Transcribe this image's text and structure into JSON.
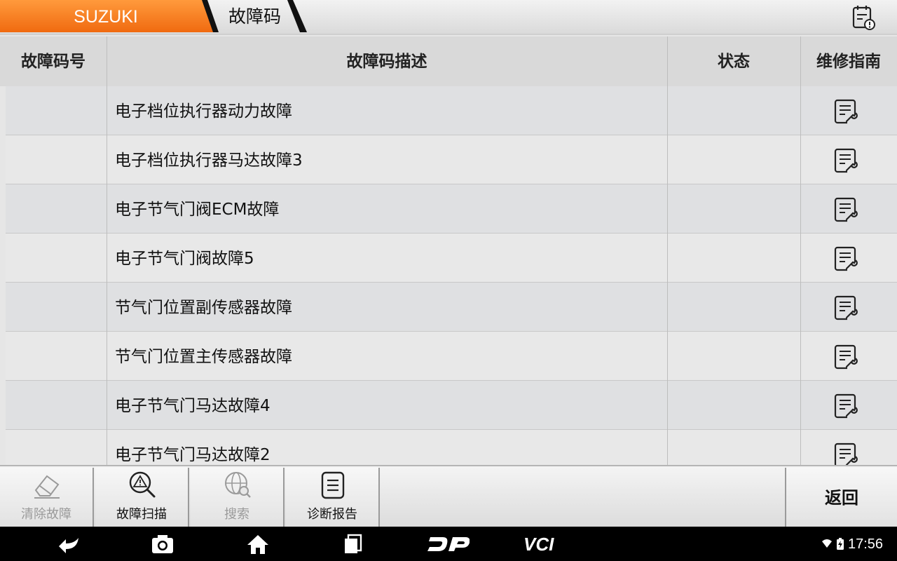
{
  "header": {
    "brand": "SUZUKI",
    "page_title": "故障码",
    "brand_color": "#f47b20"
  },
  "table": {
    "columns": [
      "故障码号",
      "故障码描述",
      "状态",
      "维修指南"
    ],
    "rows": [
      {
        "code": "",
        "description": "电子档位执行器动力故障",
        "status": ""
      },
      {
        "code": "",
        "description": "电子档位执行器马达故障3",
        "status": ""
      },
      {
        "code": "",
        "description": "电子节气门阀ECM故障",
        "status": ""
      },
      {
        "code": "",
        "description": "电子节气门阀故障5",
        "status": ""
      },
      {
        "code": "",
        "description": "节气门位置副传感器故障",
        "status": ""
      },
      {
        "code": "",
        "description": "节气门位置主传感器故障",
        "status": ""
      },
      {
        "code": "",
        "description": "电子节气门马达故障4",
        "status": ""
      },
      {
        "code": "",
        "description": "电子节气门马达故障2",
        "status": ""
      }
    ]
  },
  "toolbar": {
    "clear_label": "清除故障",
    "scan_label": "故障扫描",
    "search_label": "搜索",
    "report_label": "诊断报告",
    "back_label": "返回"
  },
  "navbar": {
    "dp_label": "DP",
    "vci_label": "VCI",
    "time": "17:56"
  },
  "icons": {
    "report": "report-icon",
    "guide": "repair-guide-icon",
    "clear": "eraser-icon",
    "scan": "warning-magnifier-icon",
    "search": "globe-search-icon",
    "diag_report": "document-icon"
  }
}
